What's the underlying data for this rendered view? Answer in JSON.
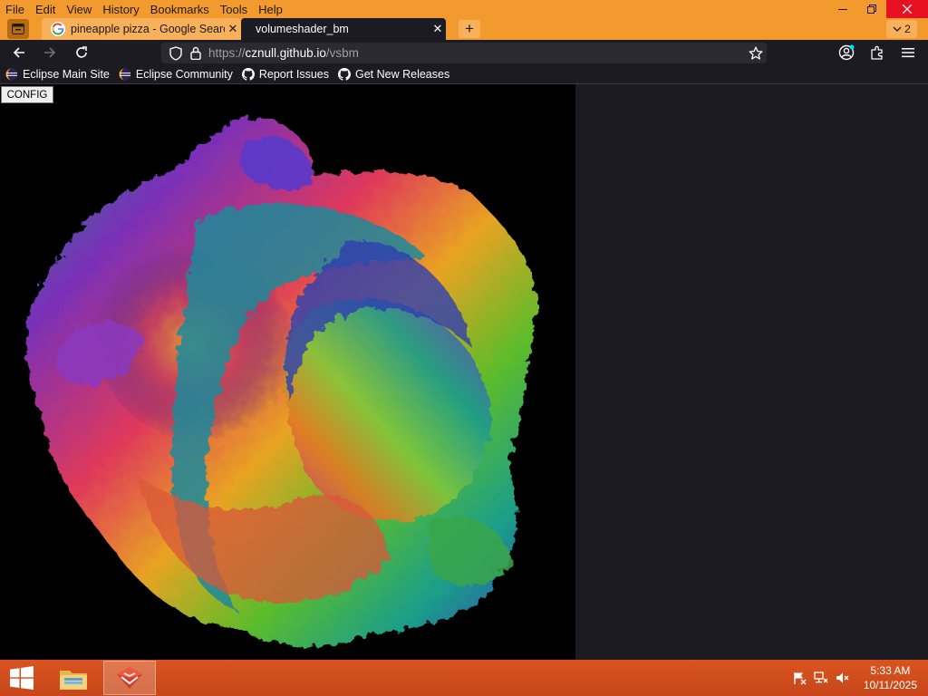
{
  "menu": [
    "File",
    "Edit",
    "View",
    "History",
    "Bookmarks",
    "Tools",
    "Help"
  ],
  "tabs": [
    {
      "title": "pineapple pizza - Google Search",
      "close": "✕",
      "active": false
    },
    {
      "title": "volumeshader_bm",
      "close": "✕",
      "active": true
    }
  ],
  "new_tab": "+",
  "tab_list_count": "2",
  "address": {
    "scheme": "https://",
    "host": "cznull.github.io",
    "path": "/vsbm"
  },
  "bookmarks": [
    {
      "label": "Eclipse Main Site",
      "icon": "eclipse-icon"
    },
    {
      "label": "Eclipse Community",
      "icon": "eclipse-icon"
    },
    {
      "label": "Report Issues",
      "icon": "github-icon"
    },
    {
      "label": "Get New Releases",
      "icon": "github-icon"
    }
  ],
  "page": {
    "config_label": "CONFIG"
  },
  "taskbar": {
    "time": "5:33 AM",
    "date": "10/11/2025"
  },
  "colors": {
    "accent": "#f29a2e",
    "browser_dark": "#1c1b22",
    "taskbar": "#d0491b",
    "close_red": "#e81123"
  }
}
